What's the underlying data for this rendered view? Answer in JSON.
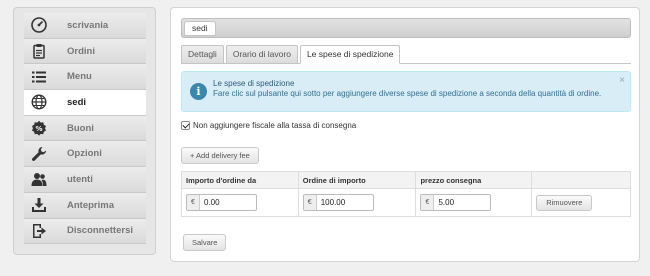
{
  "sidebar": {
    "items": [
      {
        "label": "scrivania",
        "icon": "dashboard-icon"
      },
      {
        "label": "Ordini",
        "icon": "clipboard-icon"
      },
      {
        "label": "Menu",
        "icon": "list-icon"
      },
      {
        "label": "sedi",
        "icon": "globe-icon"
      },
      {
        "label": "Buoni",
        "icon": "percent-icon"
      },
      {
        "label": "Opzioni",
        "icon": "wrench-icon"
      },
      {
        "label": "utenti",
        "icon": "users-icon"
      },
      {
        "label": "Anteprima",
        "icon": "download-icon"
      },
      {
        "label": "Disconnettersi",
        "icon": "logout-icon"
      }
    ],
    "active_index": 3
  },
  "header": {
    "title": "sedi"
  },
  "tabs": [
    "Dettagli",
    "Orario di lavoro",
    "Le spese di spedizione"
  ],
  "active_tab": 2,
  "alert": {
    "title": "Le spese di spedizione",
    "text": "Fare clic sul pulsante qui sotto per aggiungere diverse spese di spedizione a seconda della quantità di ordine.",
    "close": "×"
  },
  "checkbox": {
    "label": "Non aggiungere fiscale alla tassa di consegna",
    "checked": true
  },
  "add_button": "+ Add delivery fee",
  "table": {
    "headers": [
      "Importo d'ordine da",
      "Ordine di importo",
      "prezzo consegna",
      ""
    ],
    "row": {
      "currency": "€",
      "from": "0.00",
      "to": "100.00",
      "price": "5.00",
      "remove": "Rimuovere"
    }
  },
  "save_button": "Salvare",
  "colors": {
    "alert_bg": "#d9edf7",
    "alert_text": "#31708f",
    "info_icon": "#3a87ad"
  }
}
